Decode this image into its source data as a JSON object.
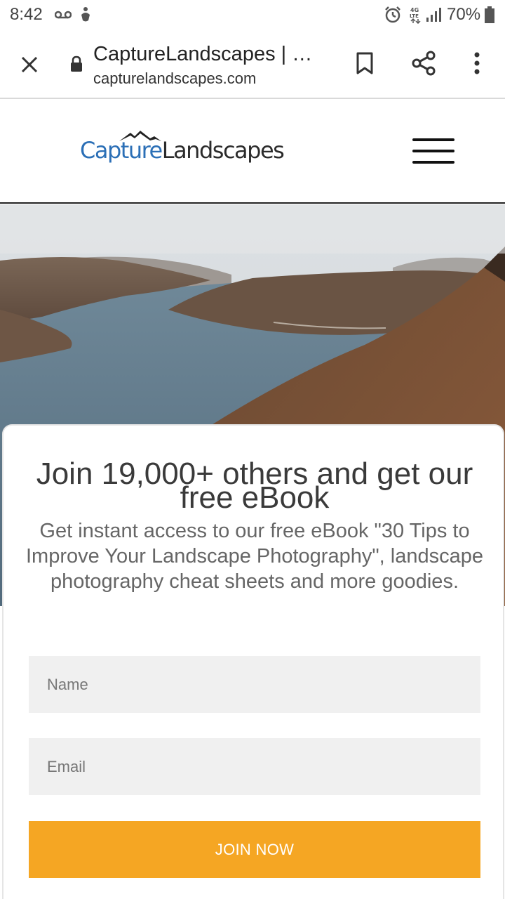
{
  "status_bar": {
    "time": "8:42",
    "battery": "70%",
    "network": "4G LTE",
    "icons": [
      "voicemail-icon",
      "accessibility-icon",
      "alarm-icon",
      "network-4g-lte-icon",
      "signal-icon",
      "battery-icon"
    ]
  },
  "browser": {
    "page_title": "CaptureLandscapes | …",
    "url": "capturelandscapes.com",
    "icons": [
      "close-icon",
      "lock-icon",
      "bookmark-icon",
      "share-icon",
      "more-vert-icon"
    ]
  },
  "site": {
    "logo": {
      "part1": "Capture",
      "part2": "Landscapes"
    },
    "menu_icon": "hamburger-menu-icon"
  },
  "popup": {
    "title": "Join 19,000+ others and get our free eBook",
    "subtitle": "Get instant access to our free eBook \"30 Tips to Improve Your Landscape Photography\", landscape photography cheat sheets and more goodies.",
    "name_placeholder": "Name",
    "email_placeholder": "Email",
    "button_label": "JOIN NOW"
  },
  "colors": {
    "accent_button": "#f5a623",
    "logo_blue": "#2b6fb6",
    "field_bg": "#f0f0f0"
  }
}
